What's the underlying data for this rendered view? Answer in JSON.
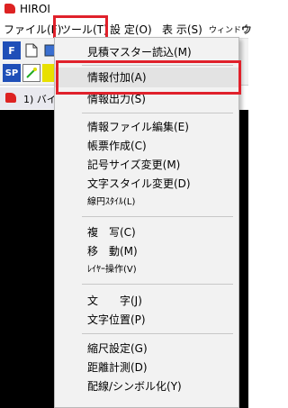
{
  "titlebar": {
    "title": "HIROI"
  },
  "menubar": {
    "file": "ファイル(F)",
    "tool": "ツール(T)",
    "settings": "設 定(O)",
    "view": "表 示(S)",
    "window": "ウィンドウ",
    "extra": "ウ"
  },
  "toolbar": {
    "f_label": "F",
    "sp_label": "SP"
  },
  "document_tab": {
    "label": "1) バイ"
  },
  "tool_menu": {
    "items": [
      "見積マスター読込(M)",
      "情報付加(A)",
      "情報出力(S)",
      "情報ファイル編集(E)",
      "帳票作成(C)",
      "記号サイズ変更(M)",
      "文字スタイル変更(D)",
      "線円ｽﾀｲﾙ(L)",
      "複　写(C)",
      "移　動(M)",
      "ﾚｲﾔｰ操作(V)",
      "文　　字(J)",
      "文字位置(P)",
      "縮尺設定(G)",
      "距離計測(D)",
      "配線/シンボル化(Y)"
    ]
  },
  "colors": {
    "highlight_border": "#e0212b",
    "canvas": "#000000",
    "app_icon": "#dd2222"
  }
}
